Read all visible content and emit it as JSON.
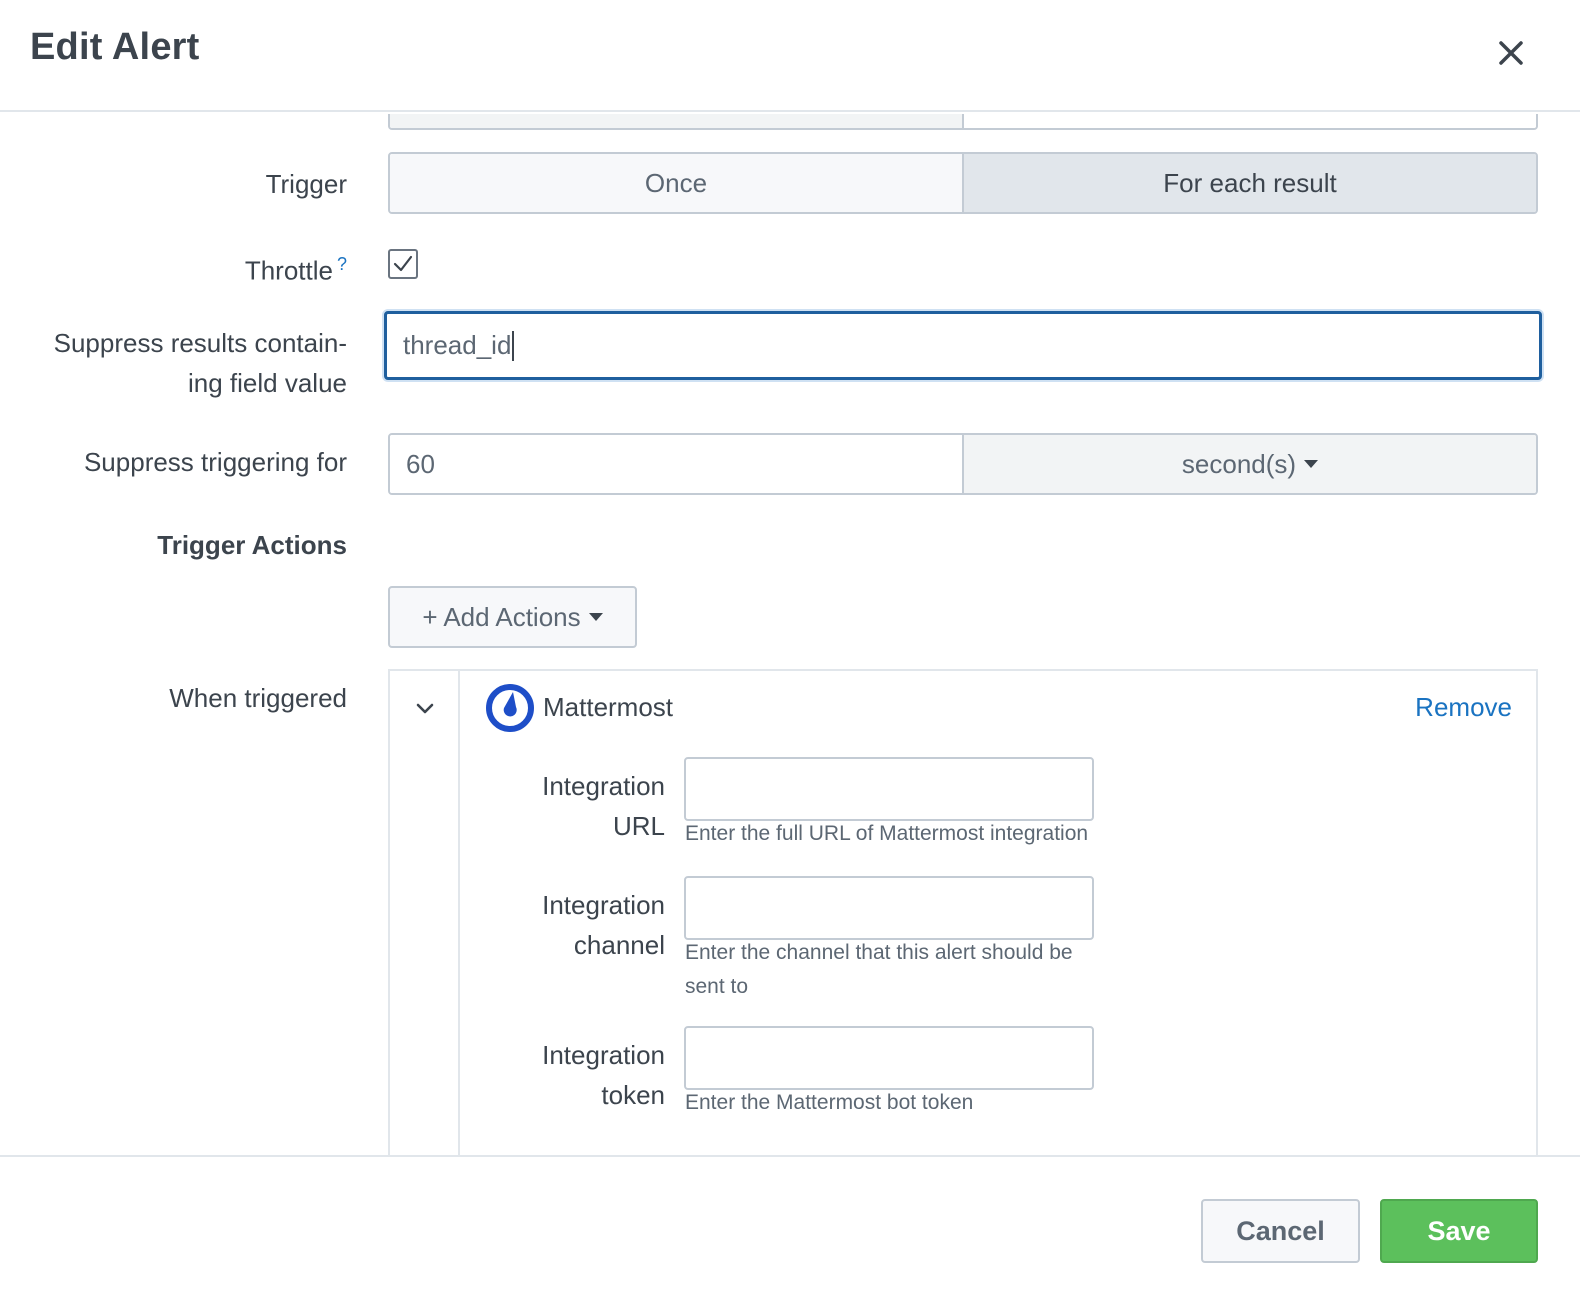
{
  "header": {
    "title": "Edit Alert",
    "close_icon": "close-icon"
  },
  "form": {
    "trigger": {
      "label": "Trigger",
      "options": [
        "Once",
        "For each result"
      ],
      "selected": "For each result"
    },
    "throttle": {
      "label": "Throttle",
      "help_mark": "?",
      "checked": true
    },
    "suppress_fields": {
      "label_line1": "Suppress results contain-",
      "label_line2": "ing field value",
      "value": "thread_id"
    },
    "suppress_period": {
      "label": "Suppress triggering for",
      "value": "60",
      "unit": "second(s)"
    },
    "trigger_actions": {
      "label": "Trigger Actions",
      "add_button": "+ Add Actions"
    },
    "when_triggered": {
      "label": "When triggered",
      "action": {
        "name": "Mattermost",
        "logo_icon": "mattermost-logo-icon",
        "remove_label": "Remove",
        "fields": [
          {
            "label_line1": "Integration",
            "label_line2": "URL",
            "value": "",
            "help_line1": "Enter the full URL of Mattermost integration",
            "help_line2": ""
          },
          {
            "label_line1": "Integration",
            "label_line2": "channel",
            "value": "",
            "help_line1": "Enter the channel that this alert should be",
            "help_line2": "sent to"
          },
          {
            "label_line1": "Integration",
            "label_line2": "token",
            "value": "",
            "help_line1": "Enter the Mattermost bot token",
            "help_line2": ""
          }
        ]
      }
    }
  },
  "footer": {
    "cancel_label": "Cancel",
    "save_label": "Save"
  },
  "colors": {
    "accent": "#1a73c1",
    "focus_border": "#1f5f9e",
    "save_green": "#5cc05c",
    "mattermost_blue": "#1e4ec8"
  }
}
